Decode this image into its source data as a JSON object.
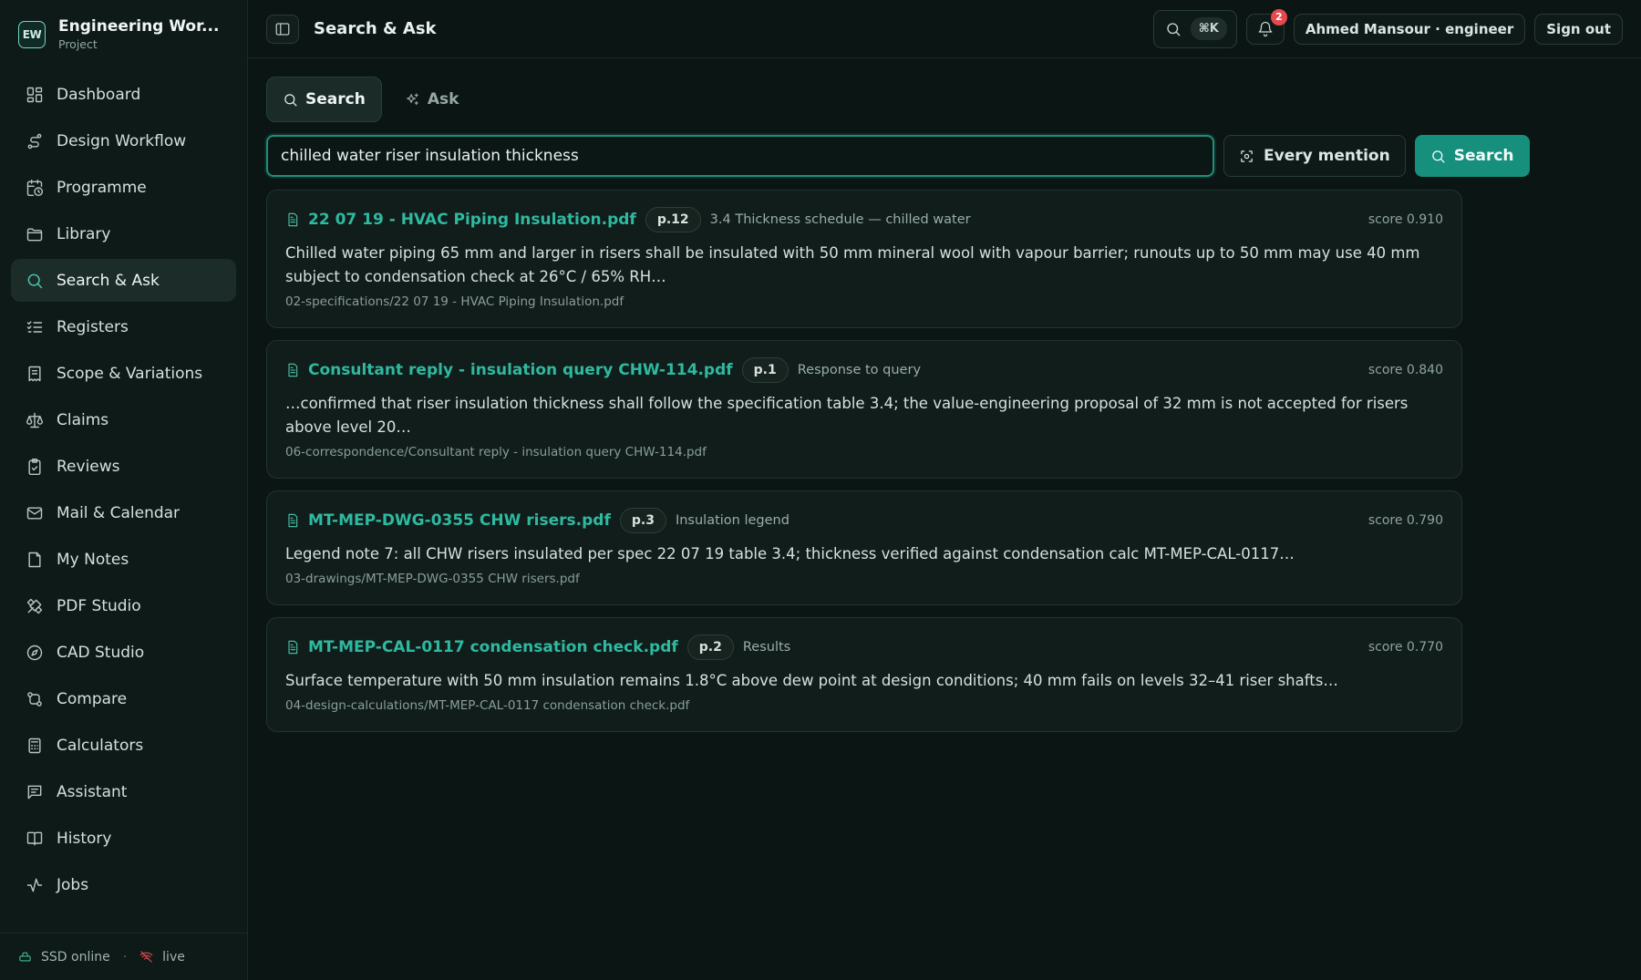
{
  "brand": {
    "logo": "EW",
    "title": "Engineering Wor...",
    "subtitle": "Project"
  },
  "sidebar": {
    "items": [
      {
        "label": "Dashboard",
        "icon": "dashboard-icon"
      },
      {
        "label": "Design Workflow",
        "icon": "workflow-icon"
      },
      {
        "label": "Programme",
        "icon": "calendar-clock-icon"
      },
      {
        "label": "Library",
        "icon": "folder-icon"
      },
      {
        "label": "Search & Ask",
        "icon": "search-icon",
        "active": true
      },
      {
        "label": "Registers",
        "icon": "checklist-icon"
      },
      {
        "label": "Scope & Variations",
        "icon": "receipt-icon"
      },
      {
        "label": "Claims",
        "icon": "scale-icon"
      },
      {
        "label": "Reviews",
        "icon": "clipboard-check-icon"
      },
      {
        "label": "Mail & Calendar",
        "icon": "mail-icon"
      },
      {
        "label": "My Notes",
        "icon": "note-icon"
      },
      {
        "label": "PDF Studio",
        "icon": "tools-icon"
      },
      {
        "label": "CAD Studio",
        "icon": "compass-icon"
      },
      {
        "label": "Compare",
        "icon": "compare-icon"
      },
      {
        "label": "Calculators",
        "icon": "calculator-icon"
      },
      {
        "label": "Assistant",
        "icon": "chat-icon"
      },
      {
        "label": "History",
        "icon": "book-icon"
      },
      {
        "label": "Jobs",
        "icon": "activity-icon"
      }
    ],
    "footer": {
      "storage": "SSD online",
      "separator": "·",
      "live": "live"
    }
  },
  "header": {
    "title": "Search & Ask",
    "shortcut": "⌘K",
    "notification_count": "2",
    "user": "Ahmed Mansour · engineer",
    "signout": "Sign out"
  },
  "tabs": [
    {
      "label": "Search",
      "active": true
    },
    {
      "label": "Ask",
      "active": false
    }
  ],
  "query": {
    "value": "chilled water riser insulation thickness",
    "mode_label": "Every mention",
    "search_label": "Search"
  },
  "results": [
    {
      "title": "22 07 19 - HVAC Piping Insulation.pdf",
      "page": "p.12",
      "section": "3.4 Thickness schedule — chilled water",
      "score": "score 0.910",
      "snippet": "Chilled water piping 65 mm and larger in risers shall be insulated with 50 mm mineral wool with vapour barrier; runouts up to 50 mm may use 40 mm subject to condensation check at 26°C / 65% RH…",
      "path": "02-specifications/22 07 19 - HVAC Piping Insulation.pdf"
    },
    {
      "title": "Consultant reply - insulation query CHW-114.pdf",
      "page": "p.1",
      "section": "Response to query",
      "score": "score 0.840",
      "snippet": "…confirmed that riser insulation thickness shall follow the specification table 3.4; the value-engineering proposal of 32 mm is not accepted for risers above level 20…",
      "path": "06-correspondence/Consultant reply - insulation query CHW-114.pdf"
    },
    {
      "title": "MT-MEP-DWG-0355 CHW risers.pdf",
      "page": "p.3",
      "section": "Insulation legend",
      "score": "score 0.790",
      "snippet": "Legend note 7: all CHW risers insulated per spec 22 07 19 table 3.4; thickness verified against condensation calc MT-MEP-CAL-0117…",
      "path": "03-drawings/MT-MEP-DWG-0355 CHW risers.pdf"
    },
    {
      "title": "MT-MEP-CAL-0117 condensation check.pdf",
      "page": "p.2",
      "section": "Results",
      "score": "score 0.770",
      "snippet": "Surface temperature with 50 mm insulation remains 1.8°C above dew point at design conditions; 40 mm fails on levels 32–41 riser shafts…",
      "path": "04-design-calculations/MT-MEP-CAL-0117 condensation check.pdf"
    }
  ],
  "colors": {
    "accent": "#2fb9a0",
    "primary_button": "#178f7d",
    "badge": "#e5484d",
    "background": "#0b1513"
  }
}
